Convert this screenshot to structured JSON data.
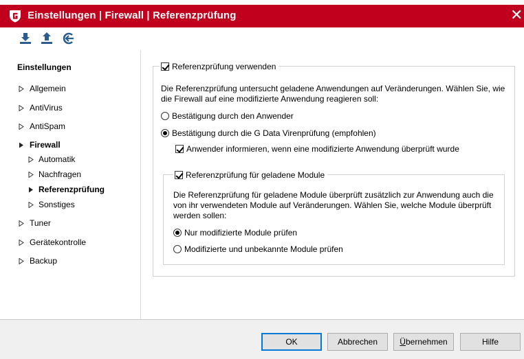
{
  "window": {
    "title": "Einstellungen | Firewall | Referenzprüfung",
    "close_glyph": "✕",
    "accent_color": "#c0001c"
  },
  "toolbar": {
    "icons": [
      "import-icon",
      "export-icon",
      "reset-icon"
    ]
  },
  "sidebar": {
    "heading": "Einstellungen",
    "items": [
      {
        "label": "Allgemein"
      },
      {
        "label": "AntiVirus"
      },
      {
        "label": "AntiSpam"
      },
      {
        "label": "Firewall",
        "expanded": true
      },
      {
        "label": "Automatik"
      },
      {
        "label": "Nachfragen"
      },
      {
        "label": "Referenzprüfung",
        "selected": true
      },
      {
        "label": "Sonstiges"
      },
      {
        "label": "Tuner"
      },
      {
        "label": "Gerätekontrolle"
      },
      {
        "label": "Backup"
      }
    ]
  },
  "main": {
    "use_check": {
      "label": "Referenzprüfung verwenden",
      "checked": true
    },
    "description": "Die Referenzprüfung untersucht geladene Anwendungen auf Veränderungen. Wählen Sie, wie die Firewall auf eine modifizierte Anwendung reagieren soll:",
    "radio_user": {
      "label": "Bestätigung durch den Anwender",
      "selected": false
    },
    "radio_gdata": {
      "label": "Bestätigung durch die G Data Virenprüfung (empfohlen)",
      "selected": true
    },
    "inform_check": {
      "label": "Anwender informieren, wenn eine modifizierte Anwendung überprüft wurde",
      "checked": true
    },
    "modules_check": {
      "label": "Referenzprüfung für geladene Module",
      "checked": true
    },
    "modules_description": "Die Referenzprüfung für geladene Module überprüft zusätzlich zur Anwendung auch die von ihr verwendeten Module auf Veränderungen. Wählen Sie, welche Module überprüft werden sollen:",
    "radio_modified": {
      "label": "Nur modifizierte Module prüfen",
      "selected": true
    },
    "radio_unknown": {
      "label": "Modifizierte und unbekannte Module prüfen",
      "selected": false
    }
  },
  "footer": {
    "ok": "OK",
    "cancel": "Abbrechen",
    "apply_prefix": "Ü",
    "apply_rest": "bernehmen",
    "help": "Hilfe"
  }
}
